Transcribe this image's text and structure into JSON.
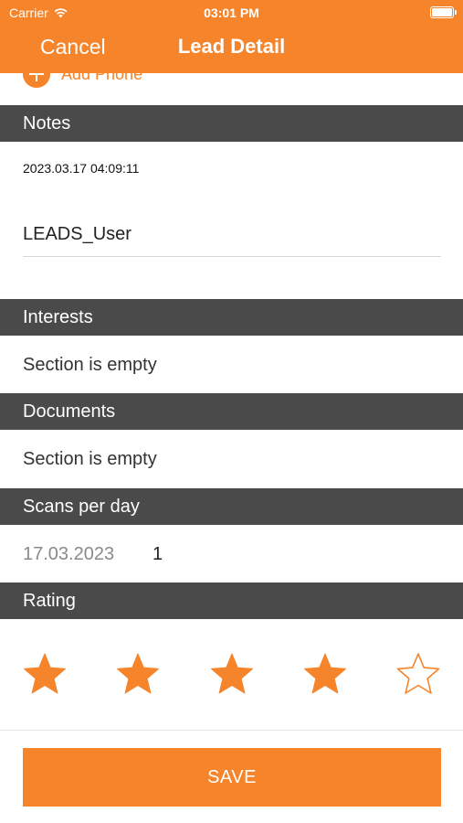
{
  "status_bar": {
    "carrier": "Carrier",
    "time": "03:01 PM",
    "wifi_icon": "wifi-icon",
    "battery_icon": "battery-icon"
  },
  "nav": {
    "cancel_label": "Cancel",
    "title": "Lead Detail"
  },
  "phone": {
    "add_label": "Add Phone",
    "icon": "plus-circle-icon"
  },
  "notes": {
    "header": "Notes",
    "timestamp": "2023.03.17 04:09:11",
    "user": "LEADS_User"
  },
  "interests": {
    "header": "Interests",
    "empty_text": "Section is empty"
  },
  "documents": {
    "header": "Documents",
    "empty_text": "Section is empty"
  },
  "scans": {
    "header": "Scans per day",
    "rows": [
      {
        "date": "17.03.2023",
        "count": "1"
      }
    ]
  },
  "rating": {
    "header": "Rating",
    "value": 4,
    "max": 5,
    "star_icon": "star-icon"
  },
  "footer": {
    "save_label": "SAVE"
  },
  "colors": {
    "accent": "#f5842a",
    "section_header": "#4a4a4a"
  }
}
